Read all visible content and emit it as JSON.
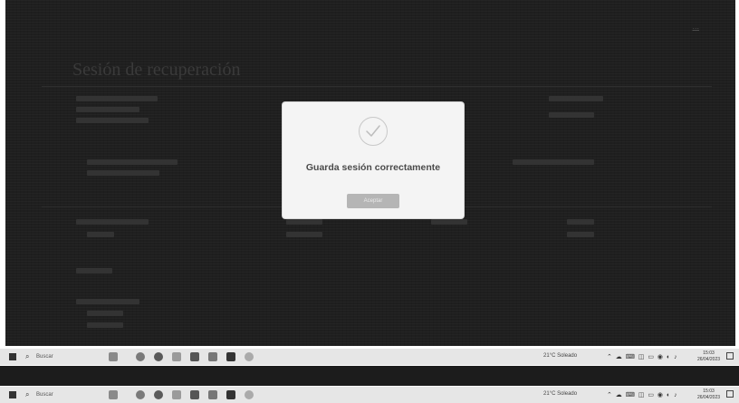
{
  "background_page": {
    "heading": "Sesión de recuperación",
    "top_link": "..."
  },
  "modal": {
    "icon": "check-icon",
    "message": "Guarda sesión correctamente",
    "button_label": "Aceptar"
  },
  "taskbar": {
    "search_label": "Buscar",
    "app_icons": [
      "widgets-icon",
      "chrome-icon",
      "edge-icon",
      "explorer-icon",
      "store-icon",
      "mail-icon",
      "app-icon",
      "weather-icon"
    ],
    "weather_text": "21°C Soleado",
    "tray_glyphs": "⌃ ☁ ⌨ ◫ ▭ ◉ ◐ ♪",
    "time": "15:03",
    "date": "26/04/2023"
  },
  "colors": {
    "screen_bg": "#1f1f1f",
    "modal_bg": "#f4f4f4",
    "button_bg": "#b5b5b5",
    "taskbar_bg": "#e6e6e6"
  }
}
